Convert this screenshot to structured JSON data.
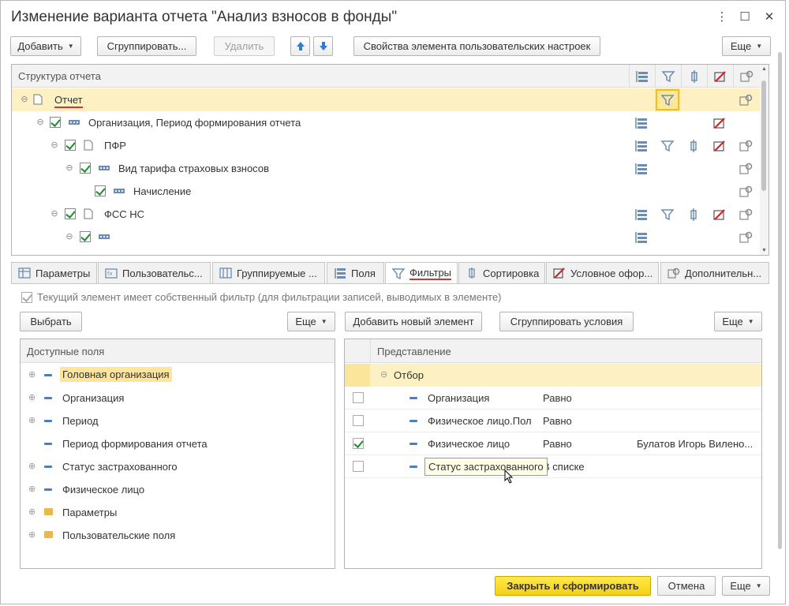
{
  "window": {
    "title": "Изменение варианта отчета \"Анализ взносов в фонды\"",
    "menu_icon": "⋮",
    "maximize_icon": "☐",
    "close_icon": "✕"
  },
  "toolbar": {
    "add_label": "Добавить",
    "group_label": "Сгруппировать...",
    "delete_label": "Удалить",
    "props_label": "Свойства элемента пользовательских настроек",
    "more_label": "Еще"
  },
  "structure": {
    "header": "Структура отчета",
    "rows": [
      {
        "label": "Отчет"
      },
      {
        "label": "Организация, Период формирования отчета"
      },
      {
        "label": "ПФР"
      },
      {
        "label": "Вид тарифа страховых взносов"
      },
      {
        "label": "Начисление"
      },
      {
        "label": "ФСС НС"
      },
      {
        "label": ""
      }
    ]
  },
  "tabs": [
    {
      "label": "Параметры"
    },
    {
      "label": "Пользовательс..."
    },
    {
      "label": "Группируемые ..."
    },
    {
      "label": "Поля"
    },
    {
      "label": "Фильтры"
    },
    {
      "label": "Сортировка"
    },
    {
      "label": "Условное офор..."
    },
    {
      "label": "Дополнительн..."
    }
  ],
  "filters": {
    "own_filter_label": "Текущий элемент имеет собственный фильтр (для фильтрации записей, выводимых в элементе)",
    "select_label": "Выбрать",
    "more_left": "Еще",
    "add_new_label": "Добавить новый элемент",
    "group_conditions_label": "Сгруппировать условия",
    "more_right": "Еще",
    "available_header": "Доступные поля",
    "available_fields": [
      {
        "label": "Головная организация"
      },
      {
        "label": "Организация"
      },
      {
        "label": "Период"
      },
      {
        "label": "Период формирования отчета"
      },
      {
        "label": "Статус застрахованного"
      },
      {
        "label": "Физическое лицо"
      },
      {
        "label": "Параметры"
      },
      {
        "label": "Пользовательские поля"
      }
    ],
    "repr_header": "Представление",
    "group_label": "Отбор",
    "conditions": [
      {
        "field": "Организация",
        "op": "Равно",
        "value": ""
      },
      {
        "field": "Физическое лицо.Пол",
        "op": "Равно",
        "value": ""
      },
      {
        "field": "Физическое лицо",
        "op": "Равно",
        "value": "Булатов Игорь Вилено..."
      },
      {
        "field": "",
        "op": "В списке",
        "value": ""
      }
    ],
    "tooltip": "Статус застрахованного"
  },
  "footer": {
    "close_generate_label": "Закрыть и сформировать",
    "cancel_label": "Отмена",
    "more_label": "Еще"
  }
}
